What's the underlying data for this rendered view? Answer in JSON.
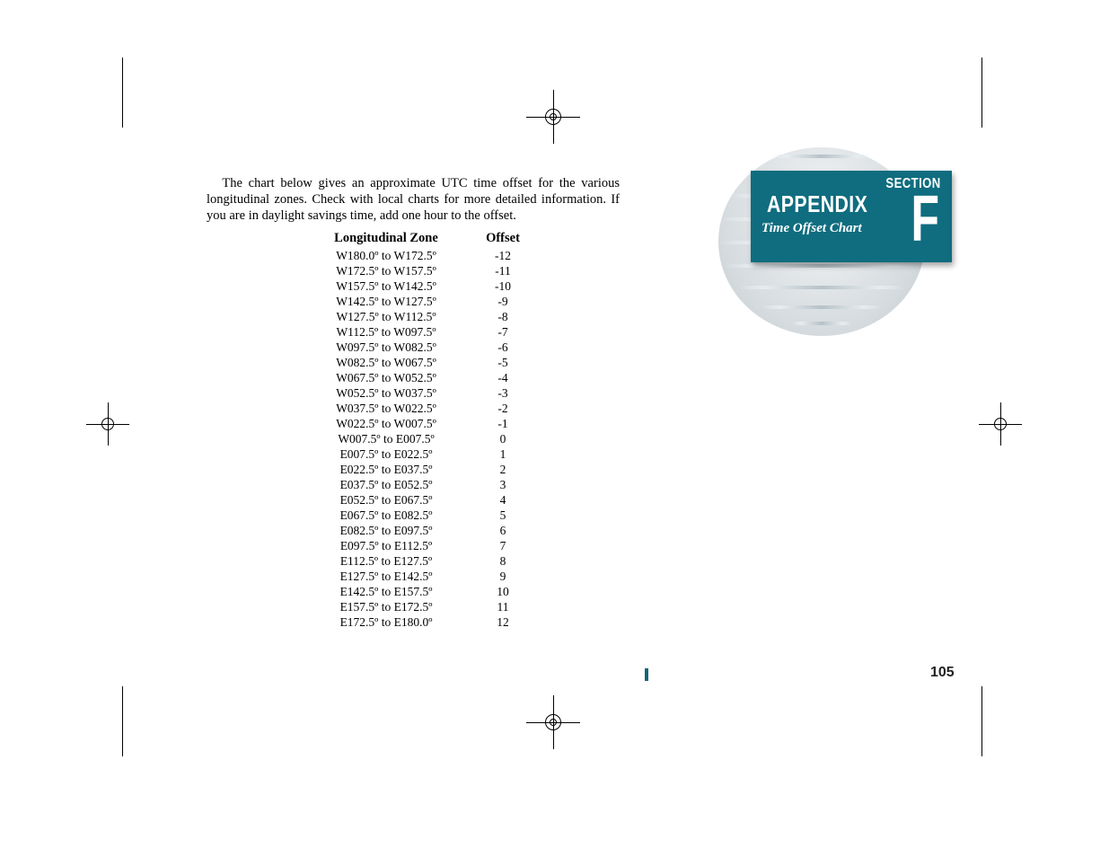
{
  "intro_text": "The chart below gives an approximate UTC time offset for the various longitudinal zones. Check with local charts for more detailed information. If you are in daylight savings time, add one hour to the offset.",
  "table": {
    "headers": {
      "zone": "Longitudinal Zone",
      "offset": "Offset"
    },
    "rows": [
      {
        "zone": "W180.0º to W172.5º",
        "offset": "-12"
      },
      {
        "zone": "W172.5º to W157.5º",
        "offset": "-11"
      },
      {
        "zone": "W157.5º to W142.5º",
        "offset": "-10"
      },
      {
        "zone": "W142.5º to W127.5º",
        "offset": "-9"
      },
      {
        "zone": "W127.5º to W112.5º",
        "offset": "-8"
      },
      {
        "zone": "W112.5º to W097.5º",
        "offset": "-7"
      },
      {
        "zone": "W097.5º to W082.5º",
        "offset": "-6"
      },
      {
        "zone": "W082.5º to W067.5º",
        "offset": "-5"
      },
      {
        "zone": "W067.5º to W052.5º",
        "offset": "-4"
      },
      {
        "zone": "W052.5º to W037.5º",
        "offset": "-3"
      },
      {
        "zone": "W037.5º to W022.5º",
        "offset": "-2"
      },
      {
        "zone": "W022.5º to W007.5º",
        "offset": "-1"
      },
      {
        "zone": "W007.5º to E007.5º",
        "offset": "0"
      },
      {
        "zone": "E007.5º to E022.5º",
        "offset": "1"
      },
      {
        "zone": "E022.5º to E037.5º",
        "offset": "2"
      },
      {
        "zone": "E037.5º to E052.5º",
        "offset": "3"
      },
      {
        "zone": "E052.5º to E067.5º",
        "offset": "4"
      },
      {
        "zone": "E067.5º to E082.5º",
        "offset": "5"
      },
      {
        "zone": "E082.5º to E097.5º",
        "offset": "6"
      },
      {
        "zone": "E097.5º to E112.5º",
        "offset": "7"
      },
      {
        "zone": "E112.5º to E127.5º",
        "offset": "8"
      },
      {
        "zone": "E127.5º to E142.5º",
        "offset": "9"
      },
      {
        "zone": "E142.5º to E157.5º",
        "offset": "10"
      },
      {
        "zone": "E157.5º to E172.5º",
        "offset": "11"
      },
      {
        "zone": "E172.5º to E180.0º",
        "offset": "12"
      }
    ]
  },
  "badge": {
    "appendix": "APPENDIX",
    "subtitle": "Time Offset Chart",
    "section_label": "SECTION",
    "section_letter": "F"
  },
  "page_number": "105",
  "chart_data": {
    "type": "table",
    "title": "UTC Time Offset by Longitudinal Zone",
    "columns": [
      "Longitudinal Zone",
      "Offset"
    ],
    "categories": [
      "W180.0º to W172.5º",
      "W172.5º to W157.5º",
      "W157.5º to W142.5º",
      "W142.5º to W127.5º",
      "W127.5º to W112.5º",
      "W112.5º to W097.5º",
      "W097.5º to W082.5º",
      "W082.5º to W067.5º",
      "W067.5º to W052.5º",
      "W052.5º to W037.5º",
      "W037.5º to W022.5º",
      "W022.5º to W007.5º",
      "W007.5º to E007.5º",
      "E007.5º to E022.5º",
      "E022.5º to E037.5º",
      "E037.5º to E052.5º",
      "E052.5º to E067.5º",
      "E067.5º to E082.5º",
      "E082.5º to E097.5º",
      "E097.5º to E112.5º",
      "E112.5º to E127.5º",
      "E127.5º to E142.5º",
      "E142.5º to E157.5º",
      "E157.5º to E172.5º",
      "E172.5º to E180.0º"
    ],
    "values": [
      -12,
      -11,
      -10,
      -9,
      -8,
      -7,
      -6,
      -5,
      -4,
      -3,
      -2,
      -1,
      0,
      1,
      2,
      3,
      4,
      5,
      6,
      7,
      8,
      9,
      10,
      11,
      12
    ]
  }
}
